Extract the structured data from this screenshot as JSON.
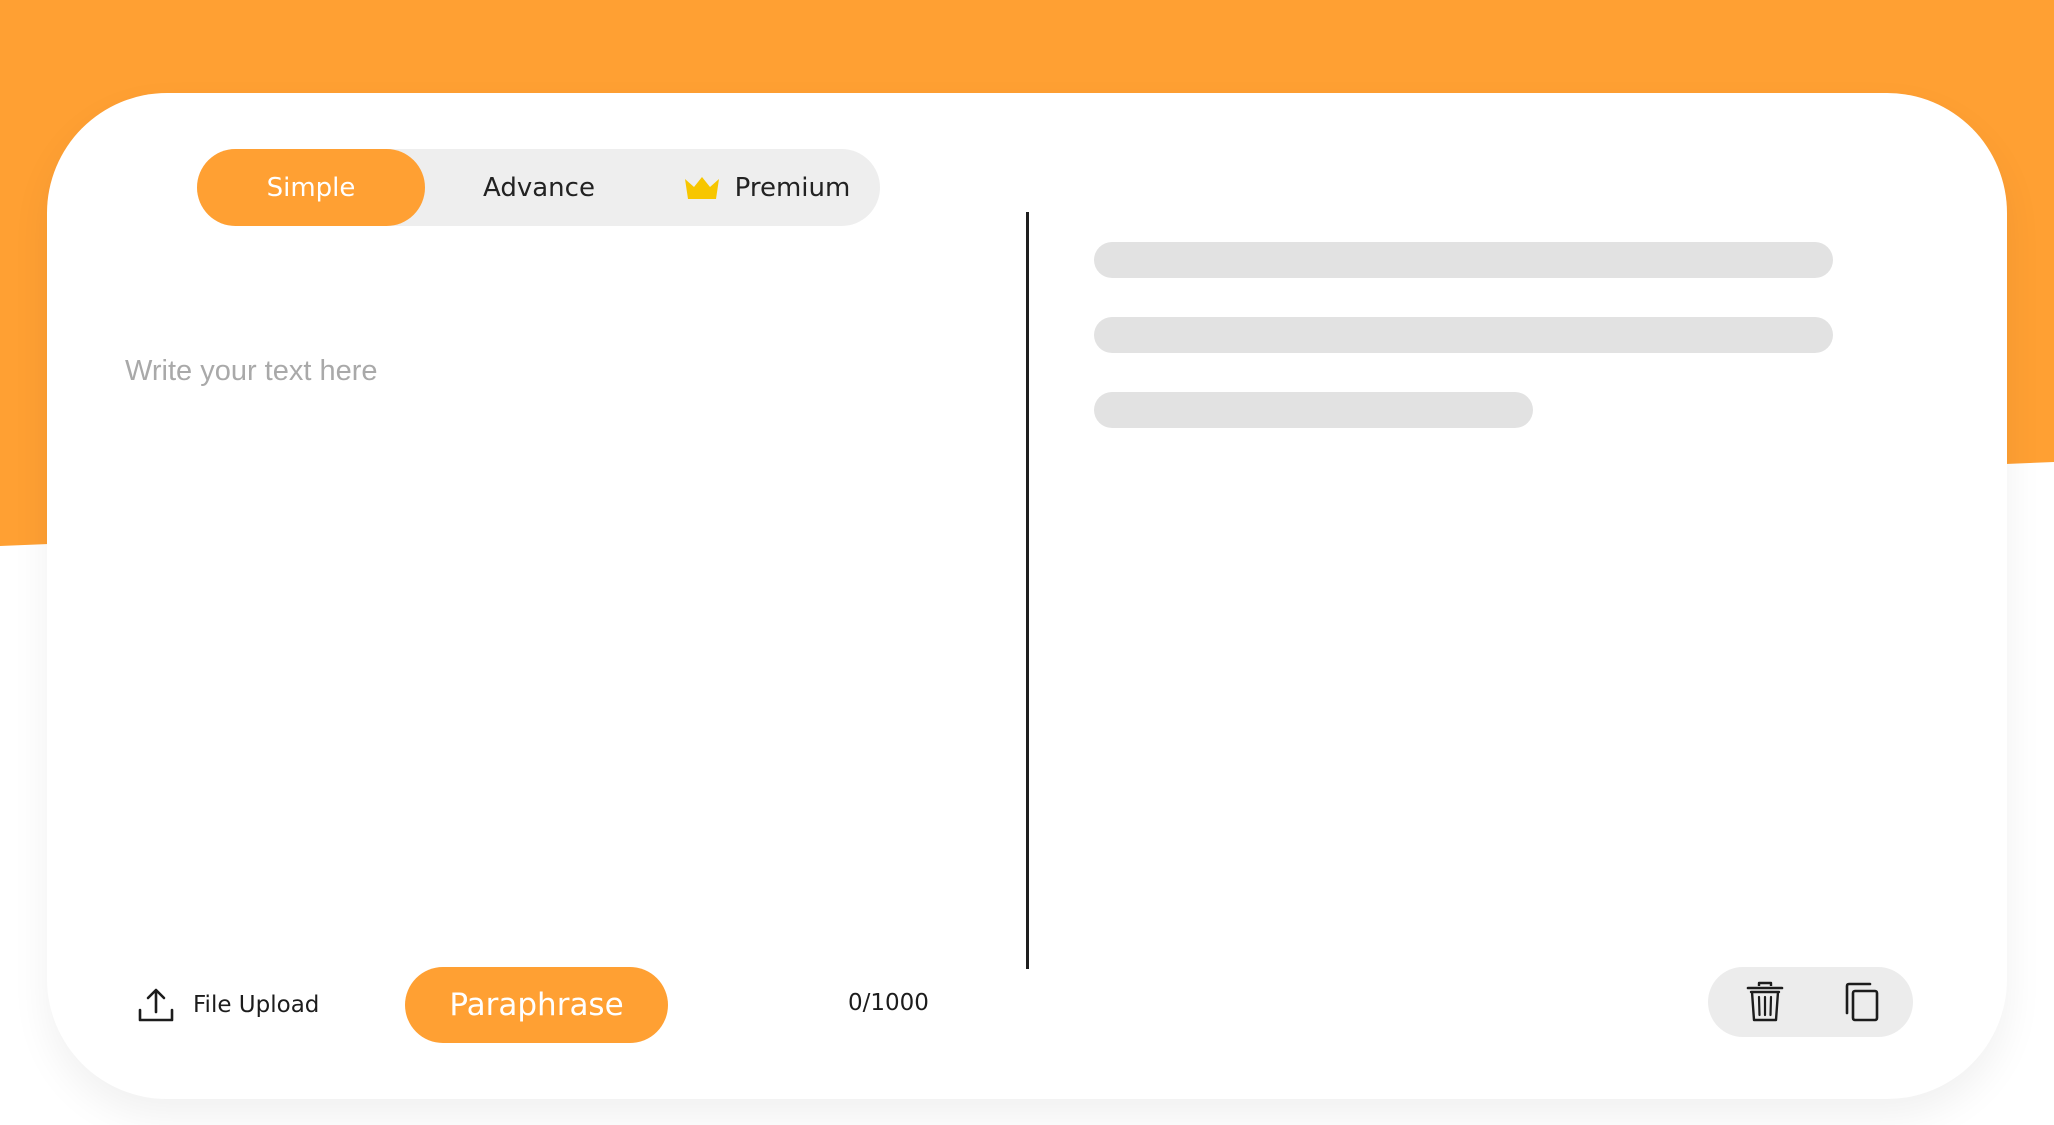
{
  "colors": {
    "accent": "#ffa033",
    "tab_track": "#eeeeee",
    "skeleton": "#e2e2e2",
    "divider": "#1e1e1e",
    "crown": "#f7c600"
  },
  "mode_tabs": [
    {
      "label": "Simple",
      "active": true
    },
    {
      "label": "Advance",
      "active": false
    },
    {
      "label": "Premium",
      "active": false,
      "icon": "crown-icon"
    }
  ],
  "editor": {
    "placeholder": "Write your text here",
    "value": ""
  },
  "footer": {
    "file_upload_label": "File Upload",
    "paraphrase_label": "Paraphrase",
    "char_count": "0/1000"
  },
  "output_actions": {
    "delete_icon": "trash-icon",
    "copy_icon": "copy-icon"
  }
}
